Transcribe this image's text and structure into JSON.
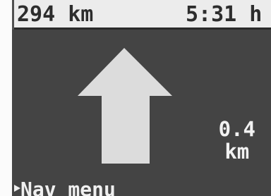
{
  "status": {
    "distance_total": "294 km",
    "time_remaining": "5:31 h"
  },
  "maneuver": {
    "icon": "straight-arrow-icon",
    "distance_value": "0.4",
    "distance_unit": "km"
  },
  "menu": {
    "label": "Nav menu"
  },
  "colors": {
    "screen_background": "#444444",
    "status_background": "#ececec",
    "text_light": "#f0f0f0",
    "arrow": "#dcdcdc"
  }
}
